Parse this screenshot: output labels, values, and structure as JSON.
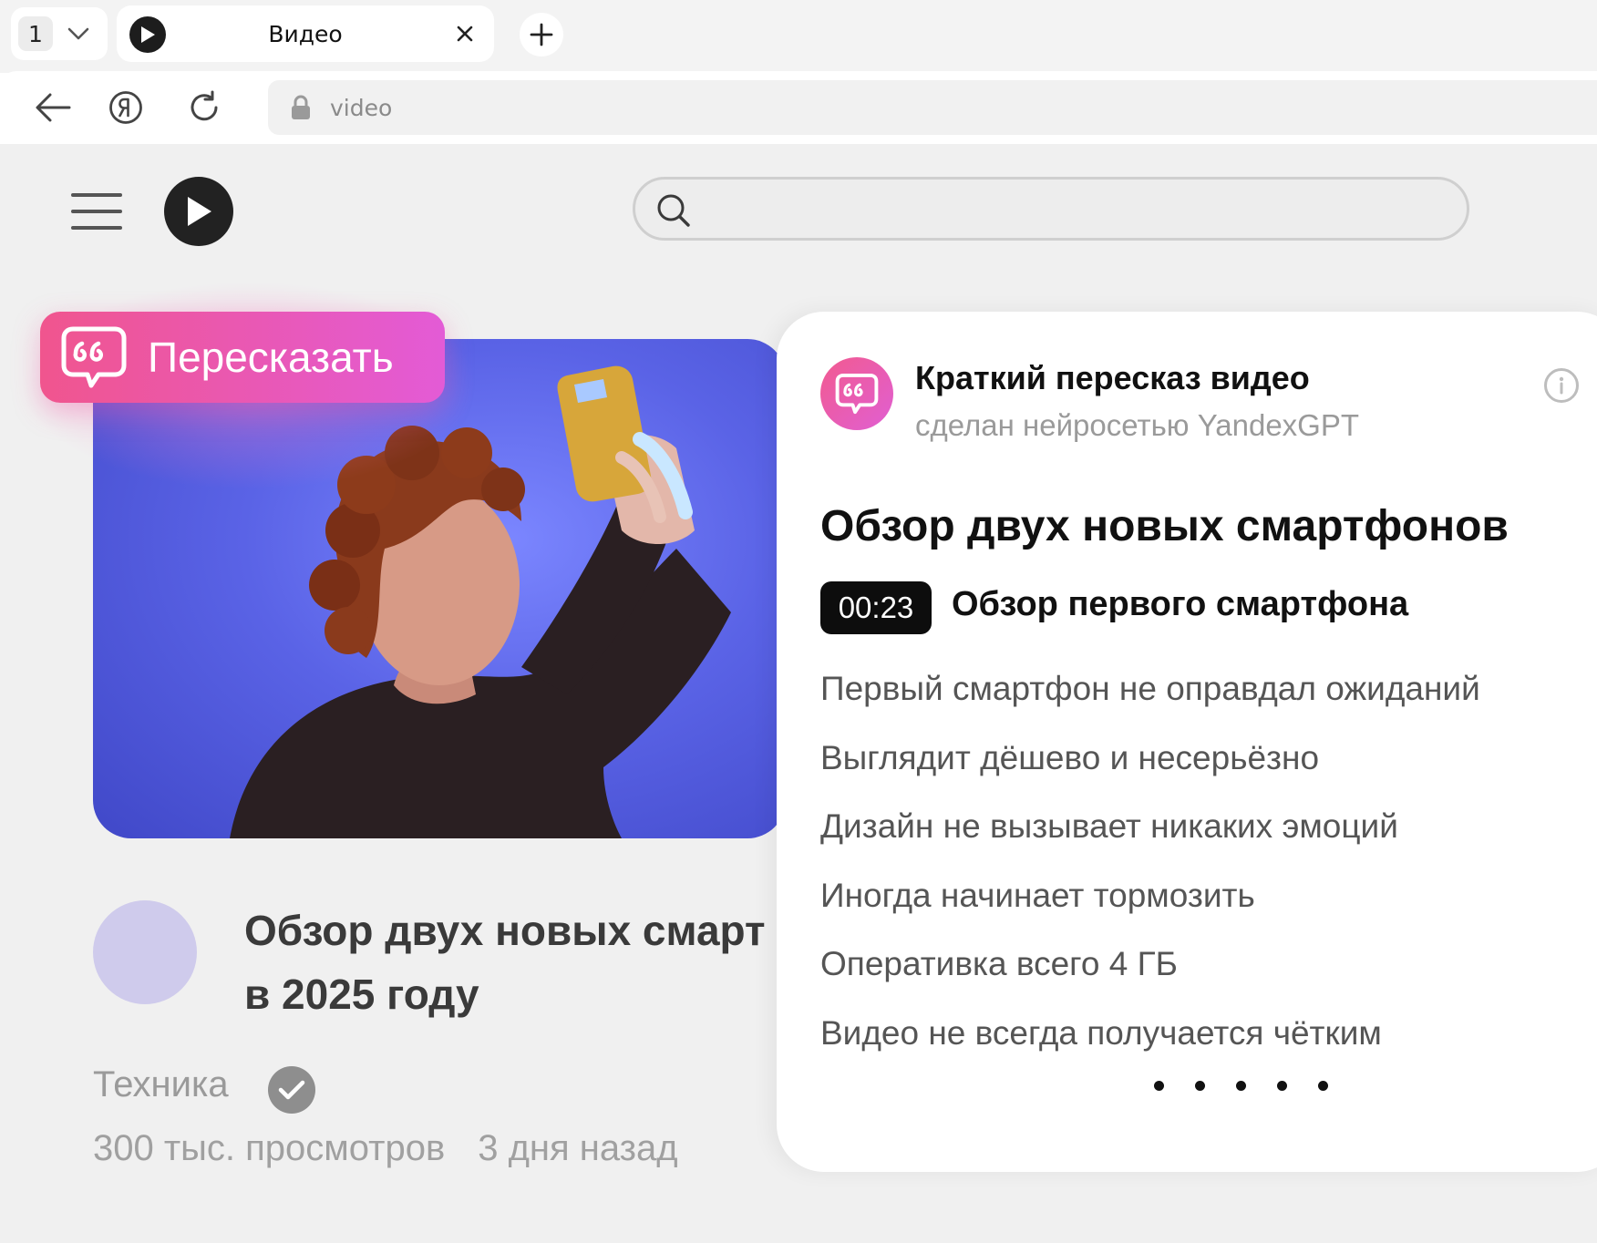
{
  "browser": {
    "tab_count": "1",
    "active_tab_title": "Видео",
    "address": "video"
  },
  "video": {
    "retell_button_label": "Пересказать",
    "title_line1": "Обзор двух новых смарт",
    "title_line2": "в 2025 году",
    "channel": "Техника",
    "views": "300 тыс. просмотров",
    "published": "3 дня назад"
  },
  "summary": {
    "heading": "Краткий пересказ видео",
    "subheading": "сделан нейросетью YandexGPT",
    "video_title": "Обзор двух новых смартфонов",
    "chapter": {
      "timecode": "00:23",
      "title": "Обзор первого смартфона"
    },
    "points": [
      "Первый смартфон не оправдал ожиданий",
      "Выглядит дёшево и несерьёзно",
      "Дизайн не вызывает никаких эмоций",
      "Иногда начинает тормозить",
      "Оперативка всего 4 ГБ",
      "Видео не всегда получается чётким"
    ]
  },
  "colors": {
    "accent_gradient_start": "#f0558e",
    "accent_gradient_end": "#e35bd6",
    "thumbnail_background": "#5a63e6"
  },
  "icons": {
    "tab_chevron": "chevron-down-icon",
    "tab_favicon": "play-icon",
    "tab_close": "close-icon",
    "new_tab": "plus-icon",
    "back": "arrow-left-icon",
    "yandex": "yandex-icon",
    "reload": "reload-icon",
    "lock": "lock-icon",
    "menu": "hamburger-icon",
    "logo": "play-icon",
    "search": "search-icon",
    "retell": "quote-bubble-icon",
    "verified": "check-icon",
    "info": "info-icon"
  }
}
